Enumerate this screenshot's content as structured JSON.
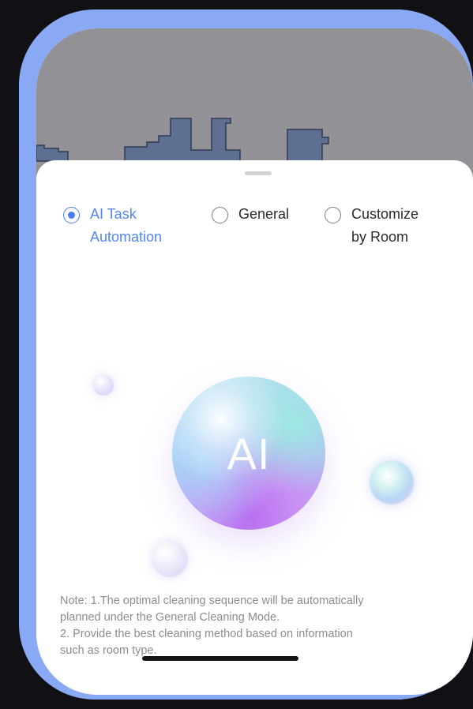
{
  "map": {
    "area_color": "#929196",
    "room_color": "#5f6f92"
  },
  "mode_options": [
    {
      "label": "AI Task Automation",
      "lines": [
        "AI Task",
        "Automation"
      ],
      "selected": true
    },
    {
      "label": "General",
      "lines": [
        "General"
      ],
      "selected": false
    },
    {
      "label": "Customize by Room",
      "lines": [
        "Customize",
        "by Room"
      ],
      "selected": false
    }
  ],
  "ai_orb": {
    "text": "AI"
  },
  "note": {
    "lines": [
      "Note: 1.The optimal cleaning sequence will be automatically",
      "planned under the General Cleaning Mode.",
      "2. Provide the best cleaning method based on information",
      "such as room type."
    ]
  },
  "colors": {
    "frame": "#8aa9f5",
    "accent": "#4a7df1",
    "note_text": "#8c8c91"
  }
}
